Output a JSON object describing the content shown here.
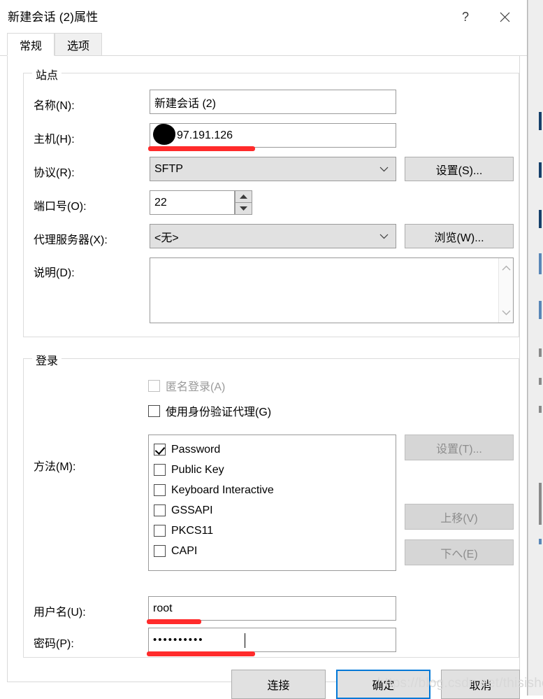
{
  "window": {
    "title": "新建会话 (2)属性",
    "help_icon": "question-mark-icon",
    "close_icon": "close-icon"
  },
  "tabs": [
    {
      "label": "常规",
      "active": true
    },
    {
      "label": "选项",
      "active": false
    }
  ],
  "site_group": {
    "title": "站点",
    "name": {
      "label": "名称(N):",
      "value": "新建会话 (2)"
    },
    "host": {
      "label": "主机(H):",
      "value": "97.191.126",
      "redacted": true
    },
    "protocol": {
      "label": "协议(R):",
      "value": "SFTP",
      "chevron": "chevron-down-icon"
    },
    "protocol_settings_button": "设置(S)...",
    "port": {
      "label": "端口号(O):",
      "value": "22"
    },
    "proxy": {
      "label": "代理服务器(X):",
      "value": "<无>",
      "chevron": "chevron-down-icon"
    },
    "proxy_browse_button": "浏览(W)...",
    "description": {
      "label": "说明(D):",
      "value": ""
    }
  },
  "login_group": {
    "title": "登录",
    "anonymous": {
      "label": "匿名登录(A)",
      "checked": false,
      "disabled": true
    },
    "auth_agent": {
      "label": "使用身份验证代理(G)",
      "checked": false,
      "disabled": false
    },
    "methods": {
      "label": "方法(M):",
      "items": [
        {
          "label": "Password",
          "checked": true
        },
        {
          "label": "Public Key",
          "checked": false
        },
        {
          "label": "Keyboard Interactive",
          "checked": false
        },
        {
          "label": "GSSAPI",
          "checked": false
        },
        {
          "label": "PKCS11",
          "checked": false
        },
        {
          "label": "CAPI",
          "checked": false
        }
      ]
    },
    "method_settings_button": "设置(T)...",
    "move_up_button": "上移(V)",
    "move_down_button": "下へ(E)",
    "username": {
      "label": "用户名(U):",
      "value": "root"
    },
    "password": {
      "label": "密码(P):",
      "value": "••••••••••",
      "masked": true
    }
  },
  "footer": {
    "connect_button": "连接",
    "ok_button": "确定",
    "cancel_button": "取消"
  },
  "watermark": "https://blog.csdn.net/thisishong",
  "colors": {
    "accent": "#0078d7",
    "annotation": "#ff2b2b",
    "control_face": "#e1e1e1",
    "disabled_text": "#8d8d8d"
  }
}
